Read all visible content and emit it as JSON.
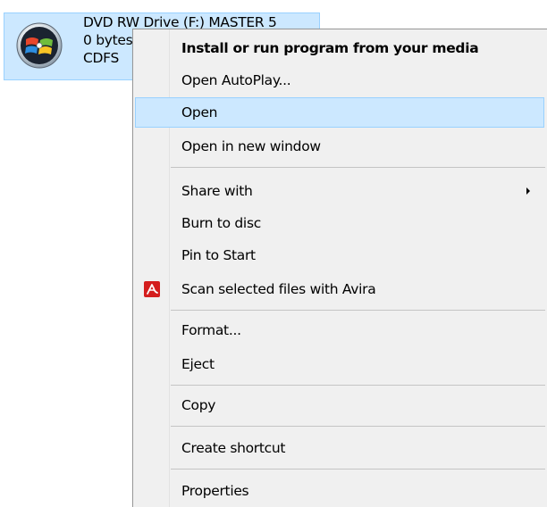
{
  "drive": {
    "name": "DVD RW Drive (F:) MASTER 5",
    "size": "0 bytes",
    "filesystem": "CDFS",
    "icon": "windows-disc-icon"
  },
  "menu": {
    "items": [
      {
        "label": "Install or run program from your media",
        "bold": true
      },
      {
        "label": "Open AutoPlay..."
      },
      {
        "label": "Open",
        "highlighted": true
      },
      {
        "label": "Open in new window"
      },
      {
        "label": "Share with",
        "submenu": true
      },
      {
        "label": "Burn to disc"
      },
      {
        "label": "Pin to Start"
      },
      {
        "label": "Scan selected files with Avira",
        "icon": "avira-icon"
      },
      {
        "label": "Format..."
      },
      {
        "label": "Eject"
      },
      {
        "label": "Copy"
      },
      {
        "label": "Create shortcut"
      },
      {
        "label": "Properties"
      }
    ]
  },
  "colors": {
    "selection_fill": "#cce8ff",
    "selection_border": "#99d1ff",
    "menu_background": "#f0f0f0",
    "avira_red": "#d41e1e"
  }
}
